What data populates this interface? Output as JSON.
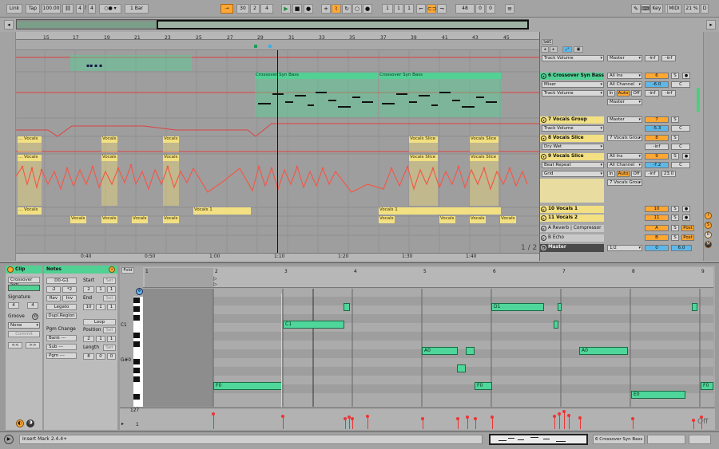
{
  "transport": {
    "link": "Link",
    "tap": "Tap",
    "tempo": "100.00",
    "time_sig_num": "4",
    "time_sig_den": "4",
    "quantize": "1 Bar",
    "position": [
      "30",
      "2",
      "4"
    ],
    "loop_start": [
      "1",
      "1",
      "1"
    ],
    "loop_length": [
      "48",
      "0",
      "0"
    ],
    "key": "Key",
    "midi": "MIDI",
    "cpu": "21 %",
    "cpu_suffix": "D"
  },
  "arrangement": {
    "ruler_bars": [
      "15",
      "17",
      "19",
      "21",
      "23",
      "25",
      "27",
      "29",
      "31",
      "33",
      "35",
      "37",
      "39",
      "41",
      "43",
      "45"
    ],
    "time_marks": [
      "0:40",
      "0:50",
      "1:00",
      "1:10",
      "1:20",
      "1:30",
      "1:40"
    ],
    "page_indicator": "1 / 2",
    "set_label": "Set",
    "clips": {
      "synbass_1": "Crossover Syn Bass",
      "synbass_2": "Crossover Syn Bass",
      "vocals": "Vocals",
      "vocals_cut": "... Vocals",
      "vocals_slice": "Vocals Slice",
      "vocals_slice_cut": "... Vocals Slice",
      "vocals_1": "Vocals 1",
      "vocals_1_cut": "... Vocals"
    }
  },
  "mixer": {
    "tracks": [
      {
        "id": "top",
        "chooser": "Track Volume",
        "io": "Master",
        "vol": "-inf",
        "pan": "-inf"
      },
      {
        "id": "6",
        "name": "6 Crossover Syn Bass",
        "device": "Mixer",
        "param": "Track Volume",
        "input": "All Ins",
        "channel": "All Channel",
        "in": "In",
        "auto": "Auto",
        "off": "Off",
        "output": "Master",
        "num": "6",
        "vol": "-6.0",
        "pan": "C",
        "vol2": "-inf",
        "pan2": "-inf"
      },
      {
        "id": "7",
        "name": "7 Vocals Group",
        "param": "Track Volume",
        "output": "Master",
        "num": "7",
        "vol": "-5.3",
        "pan": "C"
      },
      {
        "id": "8",
        "name": "8 Vocals Slice",
        "param": "Dry Wet",
        "output": "7 Vocals Grou",
        "num": "8",
        "vol": "-inf",
        "pan": "C"
      },
      {
        "id": "9",
        "name": "9 Vocals Slice",
        "device": "Beat Repeat",
        "param": "Grid",
        "input": "All Ins",
        "channel": "All Channel",
        "in": "In",
        "auto": "Auto",
        "off": "Off",
        "output": "7 Vocals Grou",
        "num": "9",
        "vol": "-7.2",
        "pan": "C",
        "vol2": "-inf",
        "pan2": "23.0"
      },
      {
        "id": "10",
        "name": "10 Vocals 1",
        "num": "10",
        "s": "S"
      },
      {
        "id": "11",
        "name": "11 Vocals 2",
        "num": "11",
        "s": "S"
      },
      {
        "id": "A",
        "name": "A Reverb | Compressor",
        "num": "A",
        "s": "S",
        "post": "Post"
      },
      {
        "id": "B",
        "name": "B Echo",
        "num": "B",
        "s": "S",
        "post": "Post"
      },
      {
        "id": "M",
        "name": "Master",
        "chooser": "1/2",
        "num": "0",
        "vol": "6.0"
      }
    ],
    "s_label": "S",
    "c_label": "C"
  },
  "clip_view": {
    "clip_title": "Clip",
    "clip_name": "Crossover Syn",
    "signature_label": "Signature",
    "sig_num": "4",
    "sig_den": "4",
    "groove_label": "Groove",
    "groove_value": "None",
    "commit": "Commit",
    "nudge_back": "<<",
    "nudge_fwd": ">>",
    "notes_title": "Notes",
    "range": "D0-G1",
    "div2": ":2",
    "mul2": "*2",
    "rev": "Rev",
    "inv": "Inv",
    "legato": "Legato",
    "dupl": "Dupl.Region",
    "pgm_change": "Pgm Change",
    "bank": "Bank ---",
    "sub": "Sub ---",
    "pgm": "Pgm ---",
    "start_label": "Start",
    "start": [
      "2",
      "1",
      "1"
    ],
    "end_label": "End",
    "end": [
      "10",
      "1",
      "1"
    ],
    "loop": "Loop",
    "position_label": "Position",
    "position": [
      "2",
      "1",
      "1"
    ],
    "length_label": "Length",
    "length": [
      "8",
      "0",
      "0"
    ],
    "set": "Set",
    "fold": "Fold",
    "bars": [
      "1",
      "2",
      "3",
      "4",
      "5",
      "6",
      "7",
      "8",
      "9"
    ],
    "key_labels": {
      "c1": "C1",
      "g0": "G#0"
    },
    "vel_max": "127",
    "vel_min": "1",
    "off": "Off",
    "notes": [
      {
        "label": "F0"
      },
      {
        "label": "C1"
      },
      {
        "label": "A0"
      },
      {
        "label": ""
      },
      {
        "label": ""
      },
      {
        "label": "F0"
      },
      {
        "label": "D1"
      },
      {
        "label": ""
      },
      {
        "label": ""
      },
      {
        "label": "A0"
      },
      {
        "label": "E0"
      },
      {
        "label": "F0"
      },
      {
        "label": ""
      },
      {
        "label": ""
      }
    ]
  },
  "status": {
    "message": "Insert Mark 2.4.4+",
    "track": "6 Crossover Syn Bass"
  }
}
